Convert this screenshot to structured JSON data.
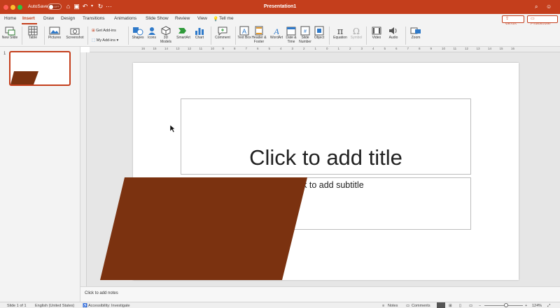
{
  "titlebar": {
    "autosave_label": "AutoSave",
    "autosave_state": "OFF",
    "document_title": "Presentation1",
    "accent_color": "#c43e1c"
  },
  "tabs": [
    {
      "label": "Home",
      "active": false
    },
    {
      "label": "Insert",
      "active": true
    },
    {
      "label": "Draw",
      "active": false
    },
    {
      "label": "Design",
      "active": false
    },
    {
      "label": "Transitions",
      "active": false
    },
    {
      "label": "Animations",
      "active": false
    },
    {
      "label": "Slide Show",
      "active": false
    },
    {
      "label": "Review",
      "active": false
    },
    {
      "label": "View",
      "active": false
    }
  ],
  "tell_me": "Tell me",
  "share_label": "Share",
  "comments_label": "Comments",
  "ribbon": {
    "new_slide": "New Slide",
    "table": "Table",
    "pictures": "Pictures",
    "screenshot": "Screenshot",
    "get_addins": "Get Add-ins",
    "my_addins": "My Add-ins",
    "shapes": "Shapes",
    "icons": "Icons",
    "models3d": "3D Models",
    "smartart": "SmartArt",
    "chart": "Chart",
    "comment": "Comment",
    "textbox": "Text Box",
    "header_footer": "Header & Footer",
    "wordart": "WordArt",
    "date_time": "Date & Time",
    "slide_number": "Slide Number",
    "object": "Object",
    "equation": "Equation",
    "symbol": "Symbol",
    "video": "Video",
    "audio": "Audio",
    "zoom": "Zoom"
  },
  "ruler_numbers": [
    "16",
    "15",
    "14",
    "13",
    "12",
    "11",
    "10",
    "9",
    "8",
    "7",
    "6",
    "5",
    "4",
    "3",
    "2",
    "1",
    "0",
    "1",
    "2",
    "3",
    "4",
    "5",
    "6",
    "7",
    "8",
    "9",
    "10",
    "11",
    "12",
    "13",
    "14",
    "15",
    "16"
  ],
  "thumbnail": {
    "number": "1"
  },
  "slide": {
    "title_placeholder": "Click to add title",
    "subtitle_placeholder": "Click to add subtitle",
    "shape_color": "#7b3210"
  },
  "notes_placeholder": "Click to add notes",
  "status": {
    "slide_of": "Slide 1 of 1",
    "language": "English (United States)",
    "accessibility": "Accessibility: Investigate",
    "notes": "Notes",
    "comments": "Comments",
    "zoom": "124%"
  }
}
